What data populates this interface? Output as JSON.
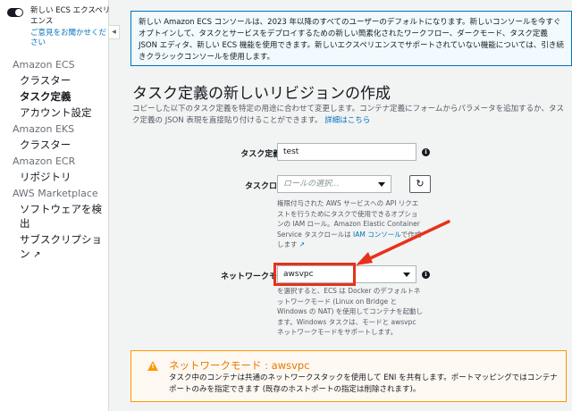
{
  "sidebar": {
    "toggle_label": "新しい ECS エクスペリエンス",
    "feedback_link": "ご意見をお聞かせください",
    "sections": [
      {
        "title": "Amazon ECS",
        "items": [
          {
            "label": "クラスター",
            "active": false
          },
          {
            "label": "タスク定義",
            "active": true
          },
          {
            "label": "アカウント設定",
            "active": false
          }
        ]
      },
      {
        "title": "Amazon EKS",
        "items": [
          {
            "label": "クラスター",
            "active": false
          }
        ]
      },
      {
        "title": "Amazon ECR",
        "items": [
          {
            "label": "リポジトリ",
            "active": false
          }
        ]
      },
      {
        "title": "AWS Marketplace",
        "items": [
          {
            "label": "ソフトウェアを検出",
            "active": false
          },
          {
            "label": "サブスクリプション",
            "active": false
          }
        ]
      }
    ],
    "collapse_icon": "chevron-left-icon",
    "external_icon": "external-link-icon"
  },
  "banner": {
    "text": "新しい Amazon ECS コンソールは、2023 年以降のすべてのユーザーのデフォルトになります。新しいコンソールを今すぐオプトインして、タスクとサービスをデプロイするための新しい簡素化されたワークフロー、ダークモード、タスク定義 JSON エディタ、新しい ECS 機能を使用できます。新しいエクスペリエンスでサポートされていない機能については、引き続きクラシックコンソールを使用します。"
  },
  "page": {
    "title": "タスク定義の新しいリビジョンの作成",
    "description": "コピーした以下のタスク定義を特定の用途に合わせて変更します。コンテナ定義にフォームからパラメータを追加するか、タスク定義の JSON 表現を直接貼り付けることができます。",
    "description_link": "詳細はこちら"
  },
  "form": {
    "task_def_name": {
      "label": "タスク定義名*",
      "value": "test"
    },
    "task_role": {
      "label": "タスクロール",
      "placeholder": "ロールの選択...",
      "help_text": "権限付与された AWS サービスへの API リクエストを行うためにタスクで使用できるオプションの IAM ロール。Amazon Elastic Container Service タスクロールは",
      "help_link": "IAM コンソール",
      "help_suffix": "で作成します"
    },
    "network_mode": {
      "label": "ネットワークモード",
      "value": "awsvpc",
      "help_text": "を選択すると、ECS は Docker のデフォルトネットワークモード (Linux on Bridge と Windows の NAT) を使用してコンテナを起動します。Windows タスクは、モードと awsvpc ネットワークモードをサポートします。"
    }
  },
  "warning": {
    "title": "ネットワークモード : awsvpc",
    "text": "タスク中のコンテナは共通のネットワークスタックを使用して ENI を共有します。ポートマッピングではコンテナポートのみを指定できます (既存のホストポートの指定は削除されます)。"
  },
  "annotation_color": "#e8311a"
}
